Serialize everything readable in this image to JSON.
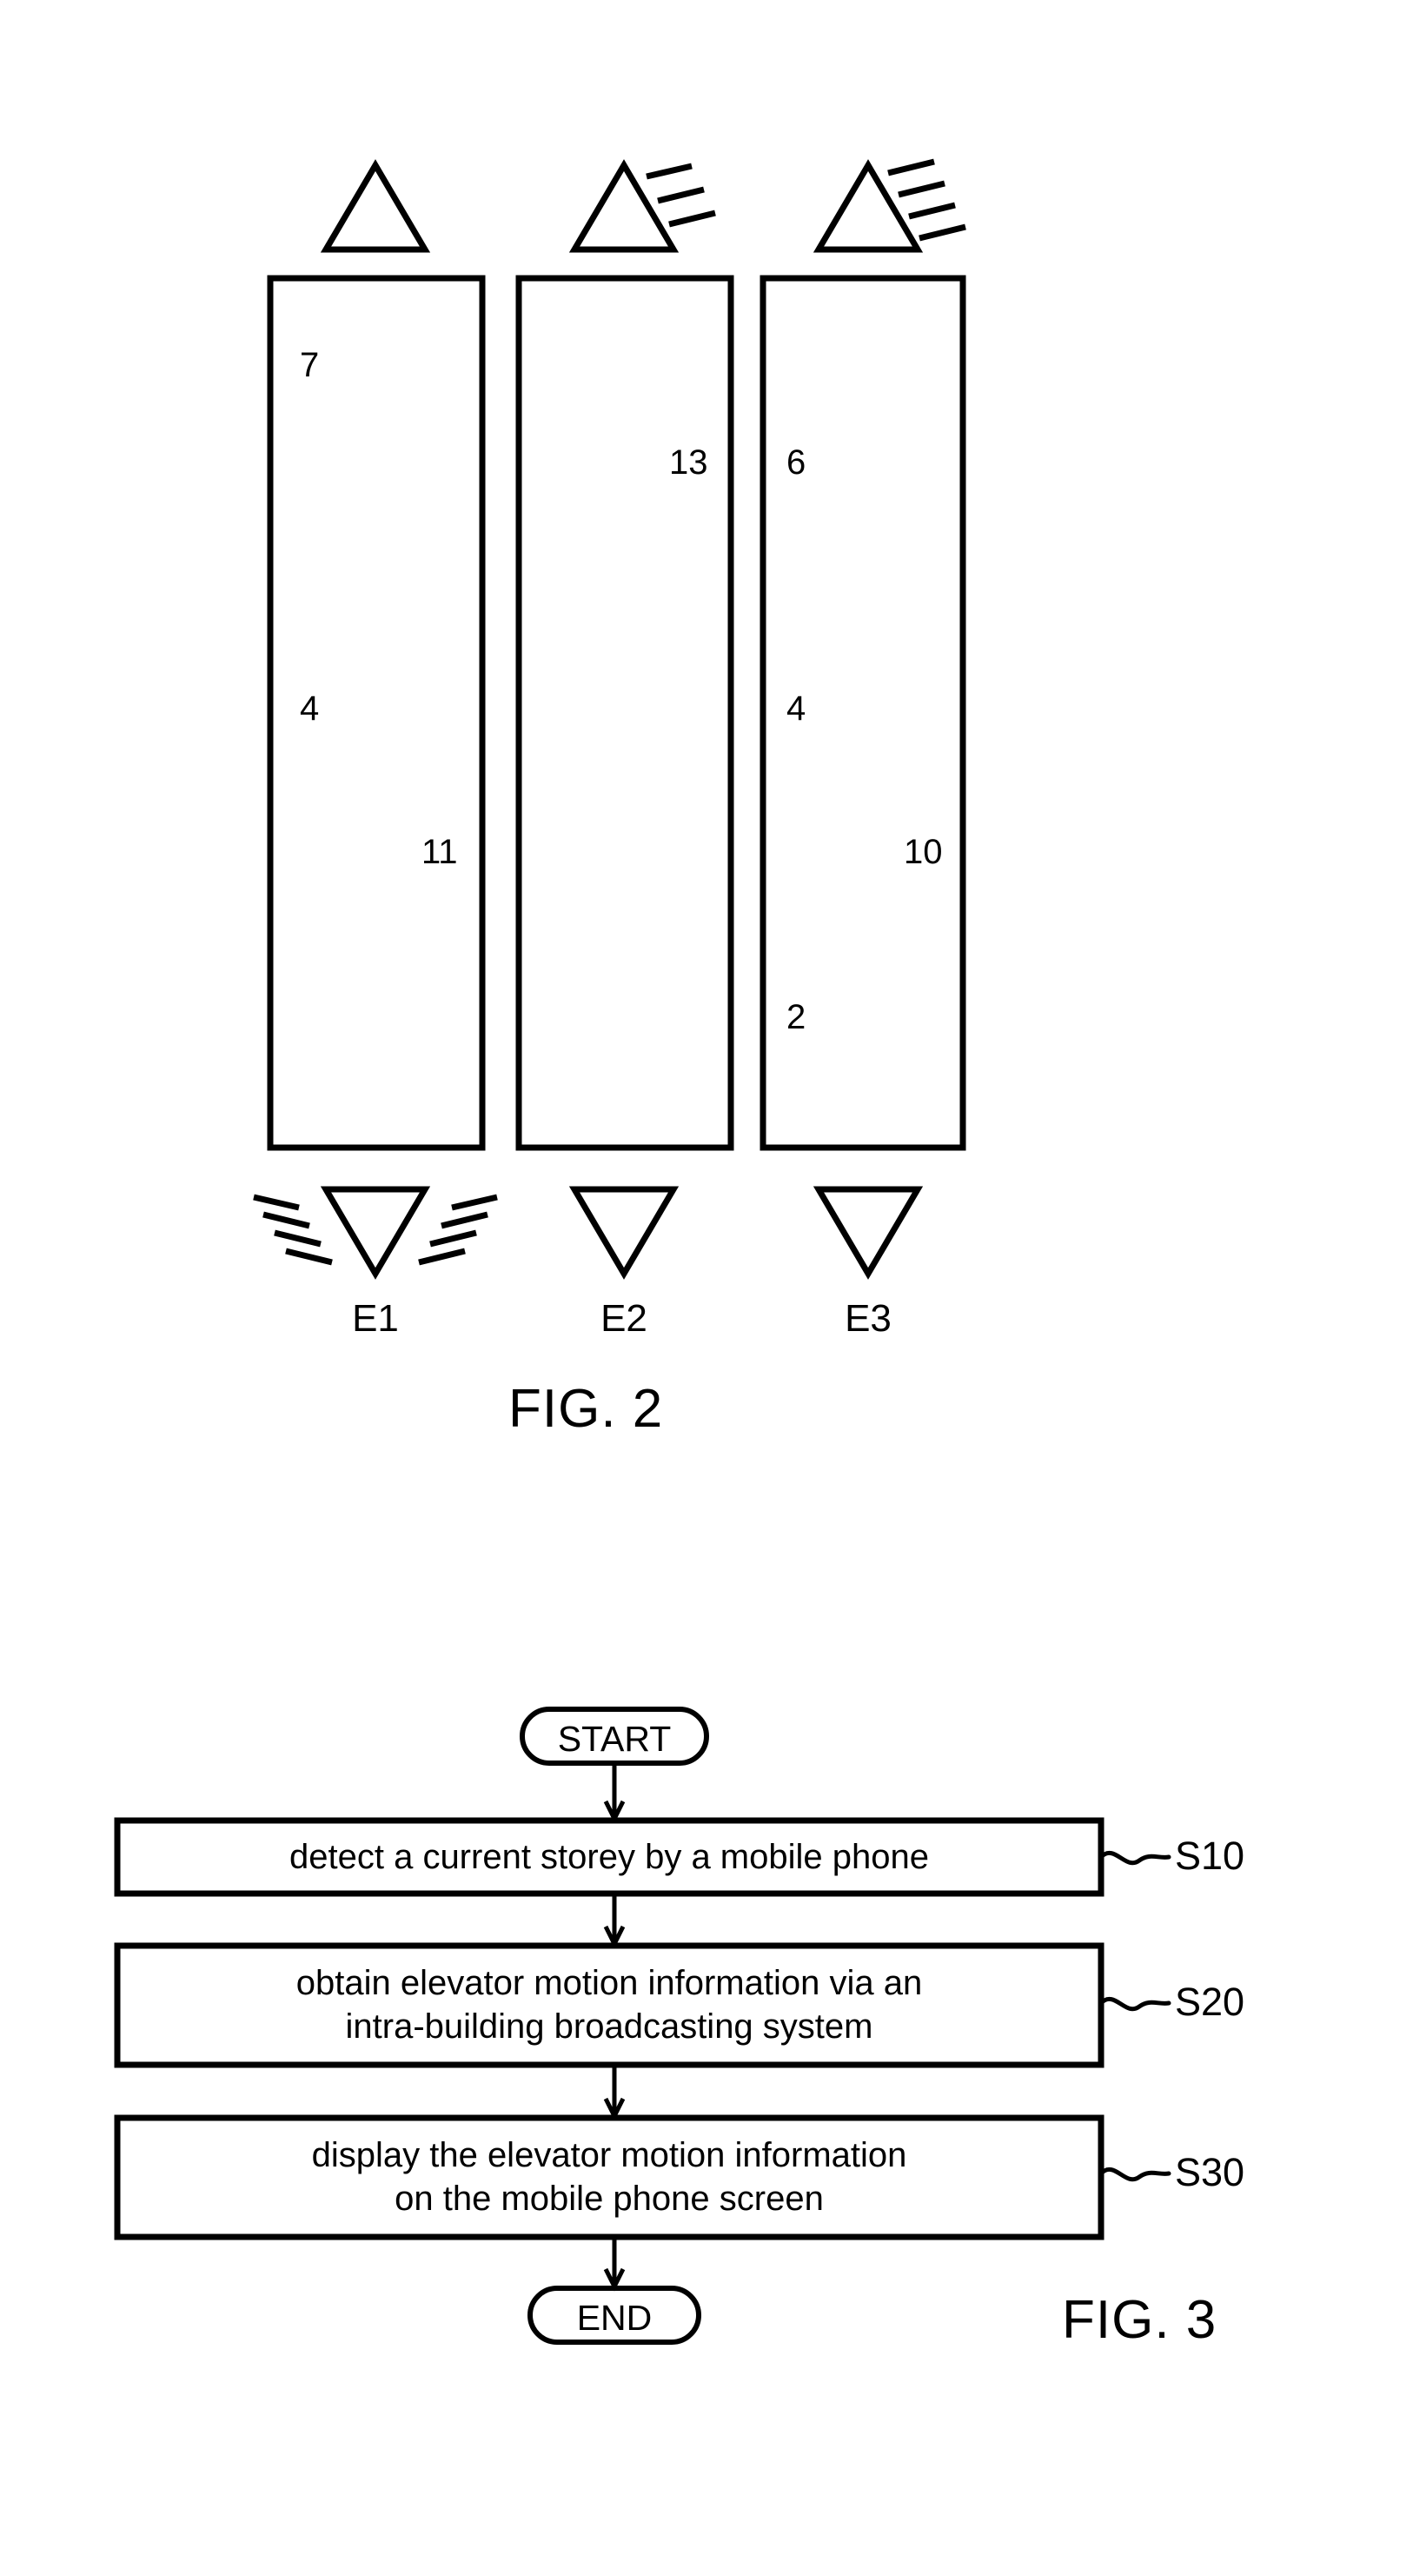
{
  "document": {
    "type": "patent-drawing-sheet",
    "figures": [
      "FIG. 2",
      "FIG. 3"
    ]
  },
  "fig2": {
    "caption": "FIG. 2",
    "elevators": [
      {
        "id": "E1",
        "label": "E1",
        "top_indicator": {
          "name": "up-arrow-indicator",
          "direction": "up",
          "rays": 0
        },
        "bottom_indicator": {
          "name": "down-arrow-indicator",
          "direction": "down",
          "rays": 8
        },
        "storey_numbers": [
          "7",
          "4",
          "11"
        ]
      },
      {
        "id": "E2",
        "label": "E2",
        "top_indicator": {
          "name": "up-arrow-indicator",
          "direction": "up",
          "rays": 3
        },
        "bottom_indicator": {
          "name": "down-arrow-indicator",
          "direction": "down",
          "rays": 0
        },
        "storey_numbers": [
          "13"
        ]
      },
      {
        "id": "E3",
        "label": "E3",
        "top_indicator": {
          "name": "up-arrow-indicator",
          "direction": "up",
          "rays": 4
        },
        "bottom_indicator": {
          "name": "down-arrow-indicator",
          "direction": "down",
          "rays": 0
        },
        "storey_numbers": [
          "6",
          "4",
          "10",
          "2"
        ]
      }
    ],
    "numbers": {
      "shaft1_7": "7",
      "shaft1_4": "4",
      "shaft1_11": "11",
      "shaft2_13": "13",
      "shaft3_6": "6",
      "shaft3_4": "4",
      "shaft3_10": "10",
      "shaft3_2": "2"
    }
  },
  "fig3": {
    "caption": "FIG. 3",
    "start_label": "START",
    "end_label": "END",
    "steps": [
      {
        "tag": "S10",
        "text": "detect a current storey by a mobile phone"
      },
      {
        "tag": "S20",
        "text": "obtain elevator motion information via an\nintra-building broadcasting system"
      },
      {
        "tag": "S30",
        "text": "display the elevator motion information\non the mobile phone screen"
      }
    ],
    "step_tags": {
      "s10": "S10",
      "s20": "S20",
      "s30": "S30"
    }
  },
  "colors": {
    "ink": "#000000",
    "paper": "#ffffff"
  }
}
